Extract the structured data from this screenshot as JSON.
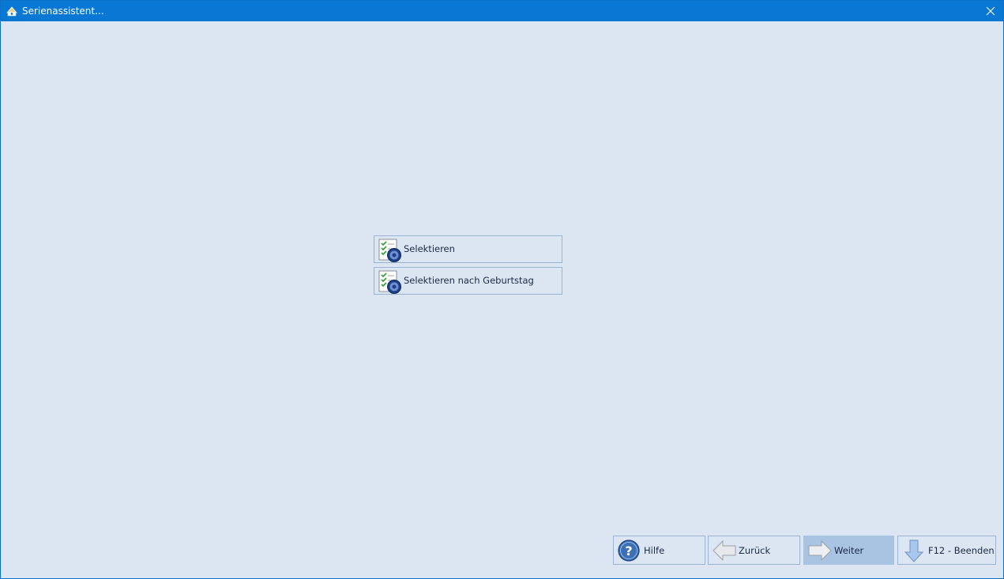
{
  "window": {
    "title": "Serienassistent..."
  },
  "options": [
    {
      "label": "Selektieren",
      "icon": "checklist-gear-icon"
    },
    {
      "label": "Selektieren nach Geburtstag",
      "icon": "checklist-gear-icon"
    }
  ],
  "footer": {
    "help_label": "Hilfe",
    "back_label": "Zurück",
    "next_label": "Weiter",
    "exit_label": "F12 - Beenden"
  },
  "colors": {
    "titlebar": "#0878d4",
    "background": "#dce6f2",
    "active_button": "#a9c3e3",
    "border": "#9ab3d2"
  }
}
